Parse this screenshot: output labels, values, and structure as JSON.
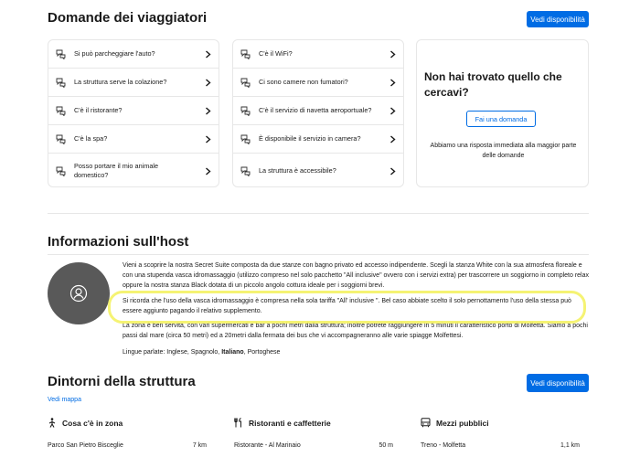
{
  "faq": {
    "title": "Domande dei viaggiatori",
    "availability_button": "Vedi disponibilità",
    "left": [
      "Si può parcheggiare l'auto?",
      "La struttura serve la colazione?",
      "C'è il ristorante?",
      "C'è la spa?",
      "Posso portare il mio animale domestico?"
    ],
    "right": [
      "C'è il WiFi?",
      "Ci sono camere non fumatori?",
      "C'è il servizio di navetta aeroportuale?",
      "È disponibile il servizio in camera?",
      "La struttura è accessibile?"
    ],
    "not_found": {
      "title": "Non hai trovato quello che cercavi?",
      "button": "Fai una domanda",
      "subtitle": "Abbiamo una risposta immediata alla maggior parte delle domande"
    }
  },
  "host": {
    "title": "Informazioni sull'host",
    "paragraph1": "Vieni a scoprire la nostra Secret Suite composta da due stanze con bagno privato ed accesso indipendente. Scegli la stanza White con la sua atmosfera floreale e con una stupenda vasca idromassaggio (utilizzo compreso nel solo pacchetto \"All inclusive\" ovvero con i servizi extra) per trascorrere un soggiorno in completo relax oppure la nostra stanza Black dotata di un piccolo angolo cottura ideale per i soggiorni brevi.",
    "paragraph2": "Si ricorda che l'uso della vasca idromassaggio è compresa nella sola tariffa \"All' inclusive \". Bel caso abbiate scelto il solo pernottamento l'uso della stessa può essere aggiunto pagando il relativo supplemento.",
    "paragraph3": "La zona è ben servita, con vari supermercati e bar a pochi metri dalla struttura; inoltre potrete raggiungere in 5 minuti il caratteristico porto di Molfetta. Siamo a pochi passi dal mare (circa 50 metri) ed a 20metri dalla fermata dei bus che vi accompagneranno alle varie spiagge Molfettesi.",
    "languages_prefix": "Lingue parlate: Inglese, Spagnolo, ",
    "languages_bold": "Italiano",
    "languages_suffix": ", Portoghese"
  },
  "surroundings": {
    "title": "Dintorni della struttura",
    "availability_button": "Vedi disponibilità",
    "map_link": "Vedi mappa",
    "columns": [
      {
        "icon": "walking-person-icon",
        "heading": "Cosa c'è in zona",
        "item": "Parco San Pietro Bisceglie",
        "distance": "7 km"
      },
      {
        "icon": "cutlery-icon",
        "heading": "Ristoranti e caffetterie",
        "item": "Ristorante - Al Marinaio",
        "distance": "50 m"
      },
      {
        "icon": "bus-icon",
        "heading": "Mezzi pubblici",
        "item": "Treno - Molfetta",
        "distance": "1,1 km"
      }
    ]
  },
  "colors": {
    "accent": "#006ce4",
    "avatar": "#595959",
    "highlight": "#f3f15a"
  }
}
